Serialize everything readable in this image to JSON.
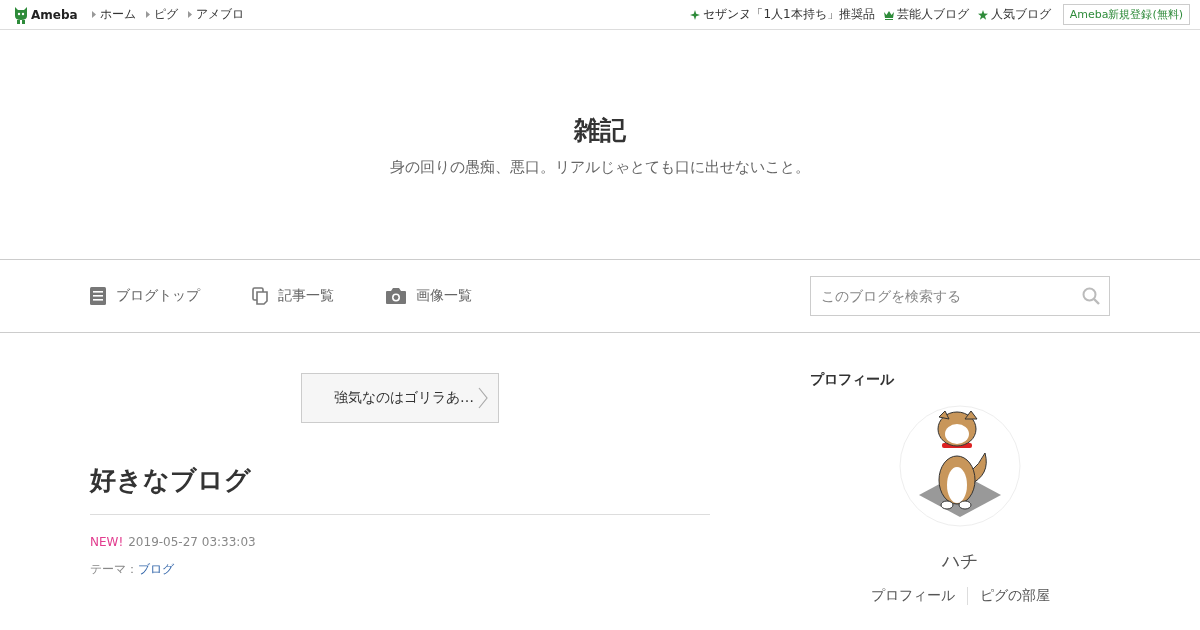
{
  "topbar": {
    "logo": "Ameba",
    "links": [
      "ホーム",
      "ピグ",
      "アメブロ"
    ],
    "right_links": [
      {
        "label": "セザンヌ「1人1本持ち」推奨品",
        "kind": "sparkle"
      },
      {
        "label": "芸能人ブログ",
        "kind": "crown"
      },
      {
        "label": "人気ブログ",
        "kind": "star"
      }
    ],
    "register": "Ameba新規登録(無料)"
  },
  "header": {
    "title": "雑記",
    "description": "身の回りの愚痴、悪口。リアルじゃとても口に出せないこと。"
  },
  "blog_nav": {
    "items": [
      {
        "label": "ブログトップ",
        "kind": "document"
      },
      {
        "label": "記事一覧",
        "kind": "pages"
      },
      {
        "label": "画像一覧",
        "kind": "camera"
      }
    ],
    "search": {
      "placeholder": "このブログを検索する"
    }
  },
  "pager": {
    "next": "強気なのはゴリラあ…"
  },
  "article": {
    "title": "好きなブログ",
    "badge": "NEW!",
    "date": "2019-05-27 03:33:03",
    "theme_label": "テーマ：",
    "theme": "ブログ"
  },
  "sidebar": {
    "heading": "プロフィール",
    "avatar": {
      "kind": "picture"
    },
    "name": "ハチ",
    "links": [
      "プロフィール",
      "ピグの部屋"
    ]
  }
}
